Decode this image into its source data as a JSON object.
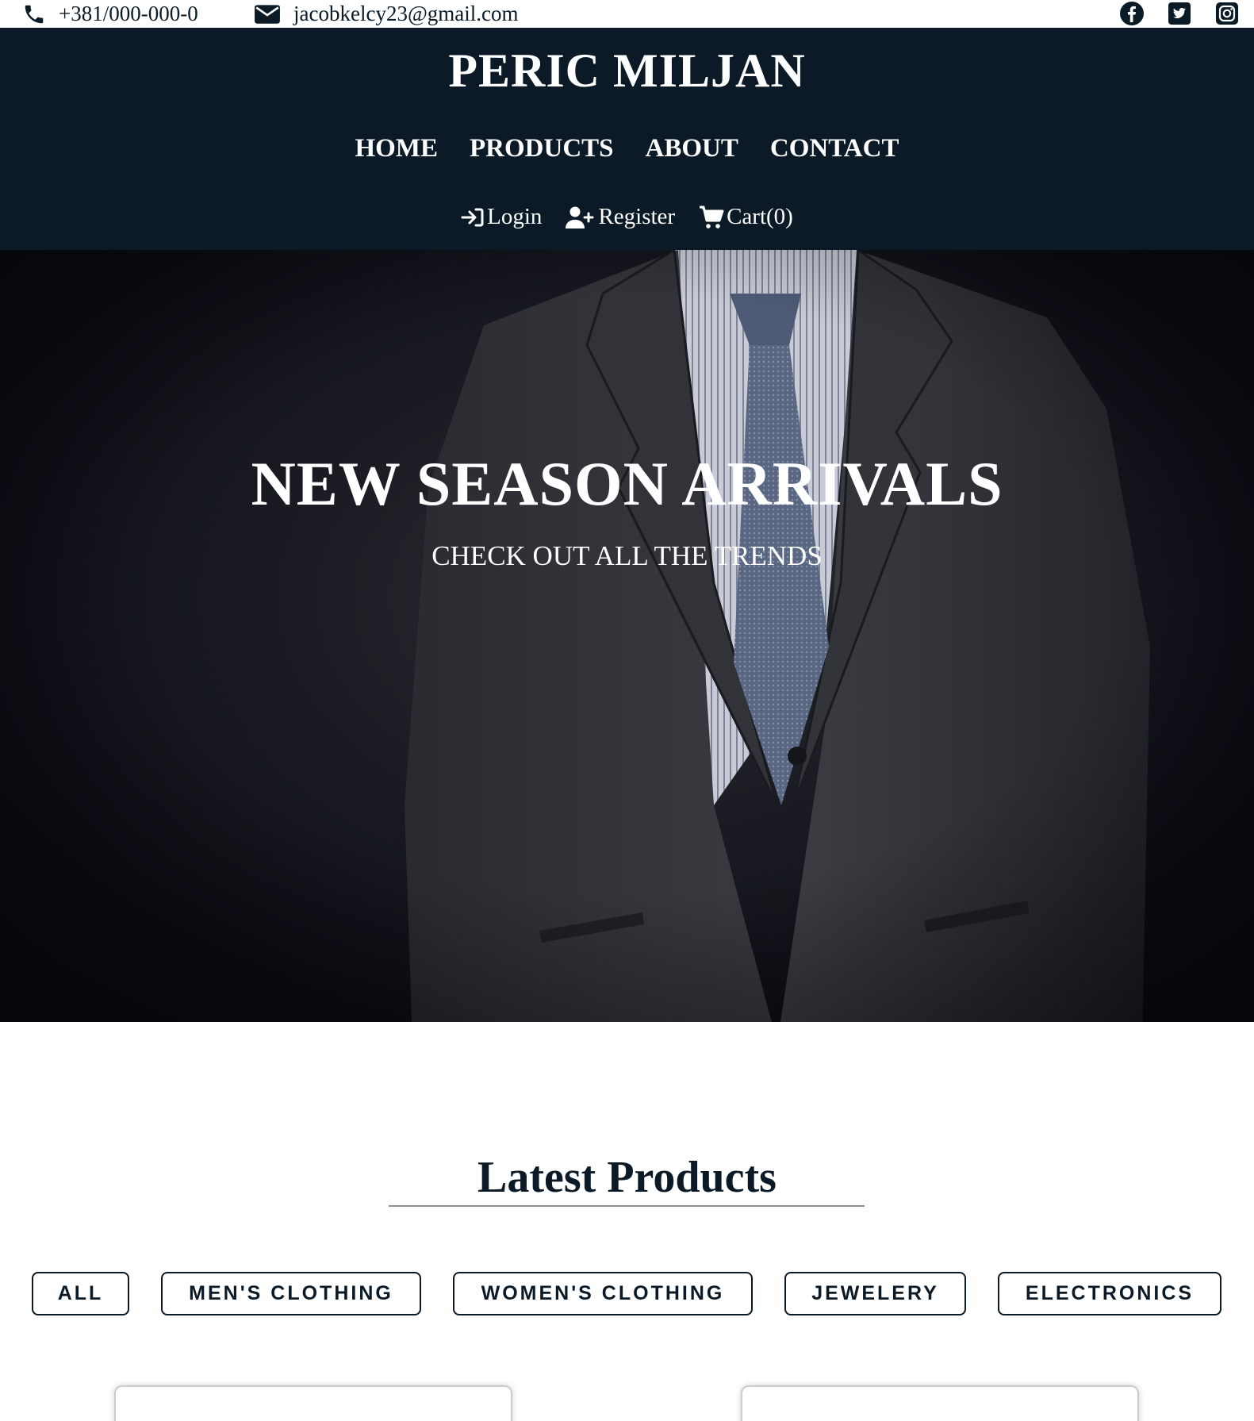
{
  "topbar": {
    "phone": "+381/000-000-0",
    "email": "jacobkelcy23@gmail.com",
    "socials": [
      "facebook-icon",
      "twitter-icon",
      "instagram-icon"
    ]
  },
  "header": {
    "brand": "PERIC MILJAN",
    "nav": [
      "HOME",
      "PRODUCTS",
      "ABOUT",
      "CONTACT"
    ],
    "auth": {
      "login": "Login",
      "register": "Register",
      "cart": "Cart(0)"
    }
  },
  "hero": {
    "title": "NEW SEASON ARRIVALS",
    "subtitle": "CHECK OUT ALL THE TRENDS"
  },
  "products": {
    "title": "Latest Products",
    "filters": [
      "ALL",
      "MEN'S CLOTHING",
      "WOMEN'S CLOTHING",
      "JEWELERY",
      "ELECTRONICS"
    ]
  },
  "colors": {
    "header_bg": "#0b1a26",
    "text_dark": "#0b1a26",
    "white": "#ffffff"
  }
}
